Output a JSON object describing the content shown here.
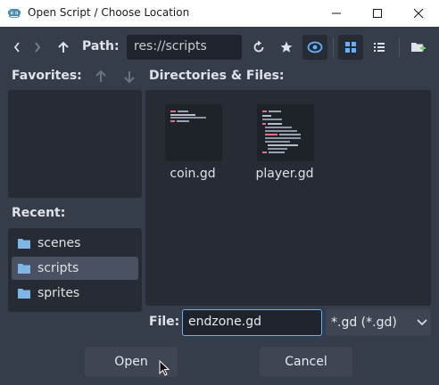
{
  "window": {
    "title": "Open Script / Choose Location"
  },
  "toolbar": {
    "path_label": "Path:",
    "path_value": "res://scripts"
  },
  "favorites": {
    "label": "Favorites:"
  },
  "recent": {
    "label": "Recent:",
    "items": [
      {
        "label": "scenes"
      },
      {
        "label": "scripts"
      },
      {
        "label": "sprites"
      }
    ]
  },
  "files": {
    "label": "Directories & Files:",
    "items": [
      {
        "name": "coin.gd"
      },
      {
        "name": "player.gd"
      }
    ]
  },
  "file_field": {
    "label": "File:",
    "value": "endzone.gd"
  },
  "filter": {
    "value": "*.gd (*.gd)"
  },
  "buttons": {
    "open": "Open",
    "cancel": "Cancel"
  },
  "colors": {
    "accent": "#5fb2ff",
    "selected": "#4a5162",
    "folder": "#7db7e6"
  }
}
